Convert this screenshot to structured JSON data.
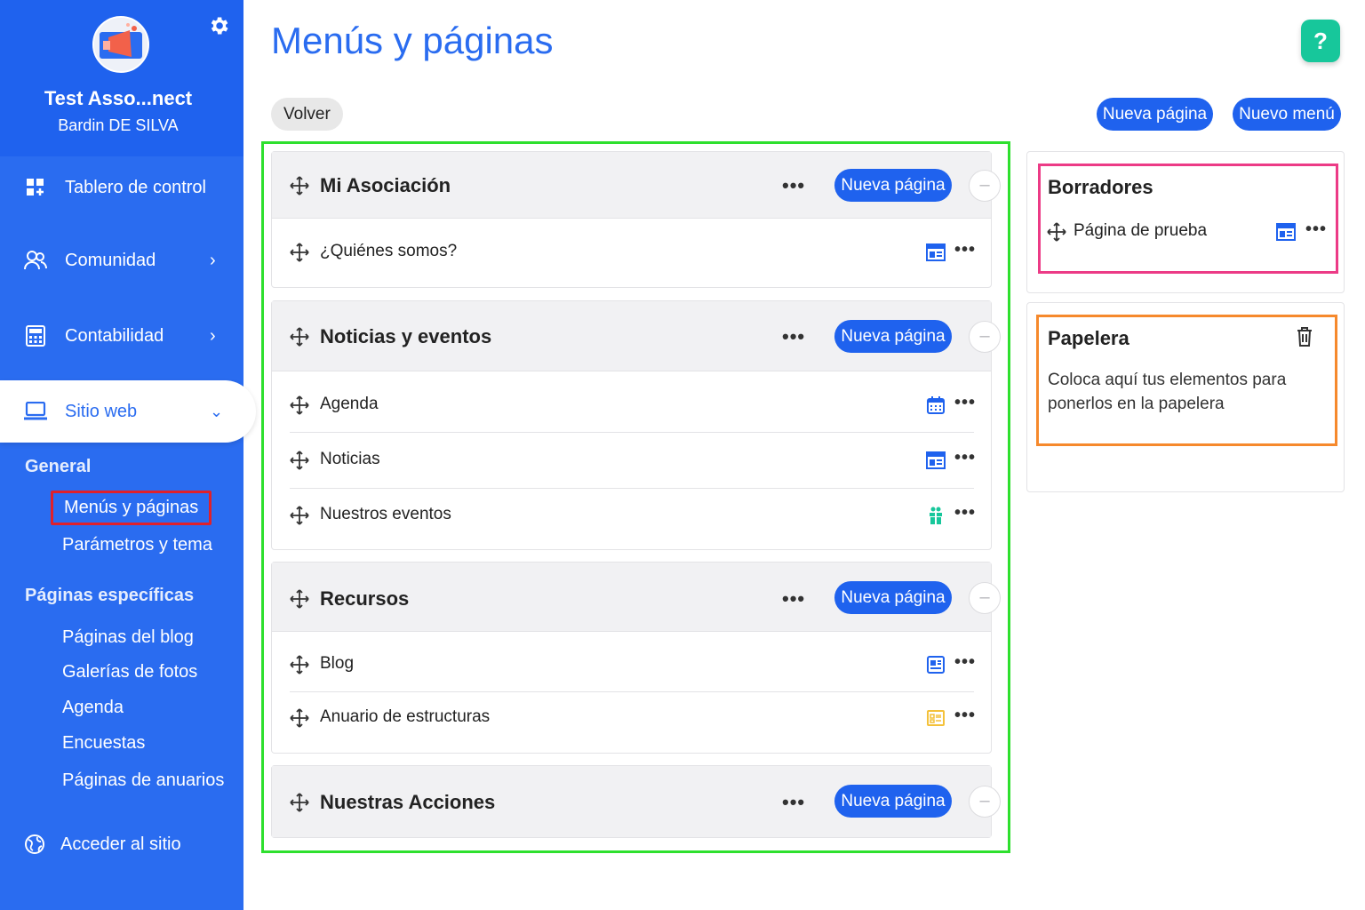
{
  "sidebar": {
    "org_name": "Test Asso...nect",
    "user_name": "Bardin DE SILVA",
    "nav": [
      {
        "label": "Tablero de control",
        "icon": "dashboard-icon"
      },
      {
        "label": "Comunidad",
        "icon": "community-icon",
        "chevron": "›"
      },
      {
        "label": "Contabilidad",
        "icon": "calculator-icon",
        "chevron": "›"
      },
      {
        "label": "Sitio web",
        "icon": "laptop-icon",
        "chevron": "⌄"
      }
    ],
    "section_general": "General",
    "general_links": [
      "Menús y páginas",
      "Parámetros y tema"
    ],
    "section_specific": "Páginas específicas",
    "specific_links": [
      "Páginas del blog",
      "Galerías de fotos",
      "Agenda",
      "Encuestas",
      "Páginas de anuarios"
    ],
    "access_site": "Acceder al sitio"
  },
  "header": {
    "title": "Menús y páginas",
    "help": "?",
    "back": "Volver",
    "new_page": "Nueva página",
    "new_menu": "Nuevo menú"
  },
  "menus": [
    {
      "title": "Mi Asociación",
      "dots": "•••",
      "new_page": "Nueva página",
      "collapse": "–",
      "pages": [
        {
          "label": "¿Quiénes somos?",
          "type": "page-layout-icon"
        }
      ]
    },
    {
      "title": "Noticias y eventos",
      "dots": "•••",
      "new_page": "Nueva página",
      "collapse": "–",
      "pages": [
        {
          "label": "Agenda",
          "type": "calendar-icon"
        },
        {
          "label": "Noticias",
          "type": "page-layout-icon"
        },
        {
          "label": "Nuestros eventos",
          "type": "gift-icon"
        }
      ]
    },
    {
      "title": "Recursos",
      "dots": "•••",
      "new_page": "Nueva página",
      "collapse": "–",
      "pages": [
        {
          "label": "Blog",
          "type": "blog-icon"
        },
        {
          "label": "Anuario de estructuras",
          "type": "directory-icon"
        }
      ]
    },
    {
      "title": "Nuestras Acciones",
      "dots": "•••",
      "new_page": "Nueva página",
      "collapse": "–",
      "pages": []
    }
  ],
  "drafts": {
    "title": "Borradores",
    "items": [
      {
        "label": "Página de prueba",
        "type": "page-layout-icon"
      }
    ]
  },
  "trash": {
    "title": "Papelera",
    "text": "Coloca aquí tus elementos para ponerlos en la papelera"
  },
  "row_dots": "•••",
  "colors": {
    "primary": "#1f62ee",
    "sidebar": "#2a6cf0",
    "help": "#17c79b",
    "frame_menus": "#2ee02e",
    "frame_drafts": "#ec3b86",
    "frame_trash": "#f6892c",
    "frame_current": "#e0202a"
  }
}
